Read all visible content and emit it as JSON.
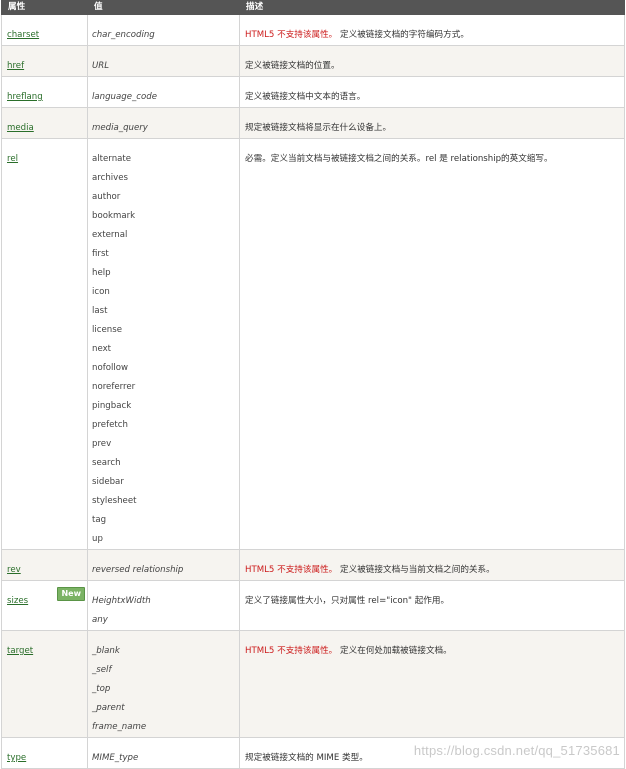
{
  "header": {
    "col_attr": "属性",
    "col_value": "值",
    "col_desc": "描述"
  },
  "rows": [
    {
      "attr": "charset",
      "values": [
        "char_encoding"
      ],
      "italic": true,
      "deprecated": "HTML5 不支持该属性。",
      "desc": "定义被链接文档的字符编码方式。"
    },
    {
      "attr": "href",
      "values": [
        "URL"
      ],
      "italic": true,
      "deprecated": "",
      "desc": "定义被链接文档的位置。"
    },
    {
      "attr": "hreflang",
      "values": [
        "language_code"
      ],
      "italic": true,
      "deprecated": "",
      "desc": "定义被链接文档中文本的语言。"
    },
    {
      "attr": "media",
      "values": [
        "media_query"
      ],
      "italic": true,
      "deprecated": "",
      "desc": "规定被链接文档将显示在什么设备上。"
    },
    {
      "attr": "rel",
      "values": [
        "alternate",
        "archives",
        "author",
        "bookmark",
        "external",
        "first",
        "help",
        "icon",
        "last",
        "license",
        "next",
        "nofollow",
        "noreferrer",
        "pingback",
        "prefetch",
        "prev",
        "search",
        "sidebar",
        "stylesheet",
        "tag",
        "up"
      ],
      "italic": false,
      "deprecated": "",
      "desc": "必需。定义当前文档与被链接文档之间的关系。rel 是 relationship的英文缩写。"
    },
    {
      "attr": "rev",
      "values": [
        "reversed relationship"
      ],
      "italic": true,
      "deprecated": "HTML5 不支持该属性。",
      "desc": "定义被链接文档与当前文档之间的关系。"
    },
    {
      "attr": "sizes",
      "badge": "New",
      "values": [
        "HeightxWidth",
        "any"
      ],
      "italic": true,
      "deprecated": "",
      "desc": "定义了链接属性大小，只对属性 rel=\"icon\" 起作用。"
    },
    {
      "attr": "target",
      "values": [
        "_blank",
        "_self",
        "_top",
        "_parent",
        "frame_name"
      ],
      "italic": true,
      "deprecated": "HTML5 不支持该属性。",
      "desc": "定义在何处加载被链接文档。"
    },
    {
      "attr": "type",
      "values": [
        "MIME_type"
      ],
      "italic": true,
      "deprecated": "",
      "desc": "规定被链接文档的 MIME 类型。"
    }
  ],
  "watermark": "https://blog.csdn.net/qq_51735681"
}
